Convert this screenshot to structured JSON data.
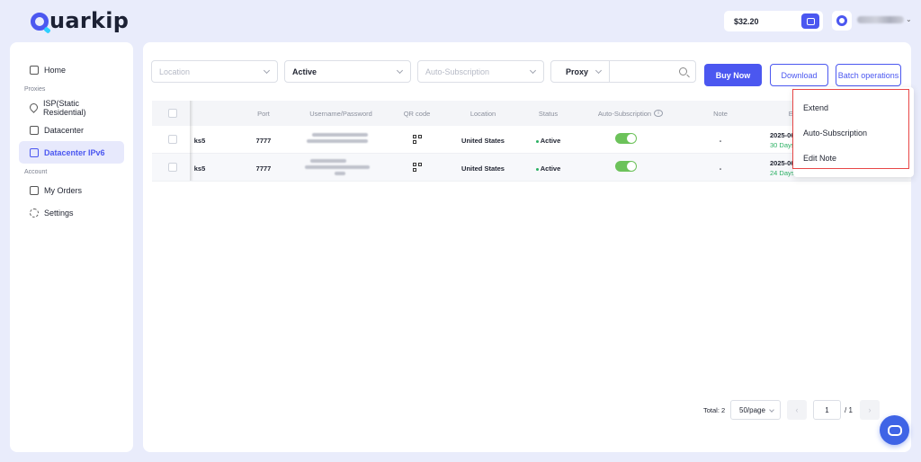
{
  "brand": {
    "name": "uarkip"
  },
  "header": {
    "balance": "$32.20"
  },
  "sidebar": {
    "home": "Home",
    "proxies_label": "Proxies",
    "items": [
      "ISP(Static Residential)",
      "Datacenter",
      "Datacenter IPv6"
    ],
    "account_label": "Account",
    "account_items": [
      "My Orders",
      "Settings"
    ]
  },
  "filters": {
    "location_placeholder": "Location",
    "status_value": "Active",
    "auto_sub_placeholder": "Auto-Subscription",
    "proxy_type": "Proxy"
  },
  "actions": {
    "buy_now": "Buy Now",
    "download": "Download",
    "batch": "Batch operations"
  },
  "table": {
    "headers": [
      "Port",
      "Username/Password",
      "QR code",
      "Location",
      "Status",
      "Auto-Subscription",
      "Note",
      "Expi"
    ],
    "rows": [
      {
        "protocol": "ks5",
        "port": "7777",
        "location": "United States",
        "status": "Active",
        "note": "-",
        "expiry": "2025-06",
        "days": "30 Days"
      },
      {
        "protocol": "ks5",
        "port": "7777",
        "location": "United States",
        "status": "Active",
        "note": "-",
        "expiry": "2025-06",
        "days": "24 Days"
      }
    ]
  },
  "dropdown": {
    "items": [
      "Extend",
      "Auto-Subscription",
      "Edit Note"
    ]
  },
  "pagination": {
    "total": "Total: 2",
    "page_size": "50/page",
    "current": "1",
    "of": "/ 1"
  },
  "colors": {
    "accent": "#4b57f0",
    "active": "#2cb164",
    "toggle_on": "#6cc25a",
    "highlight": "#e84747"
  }
}
